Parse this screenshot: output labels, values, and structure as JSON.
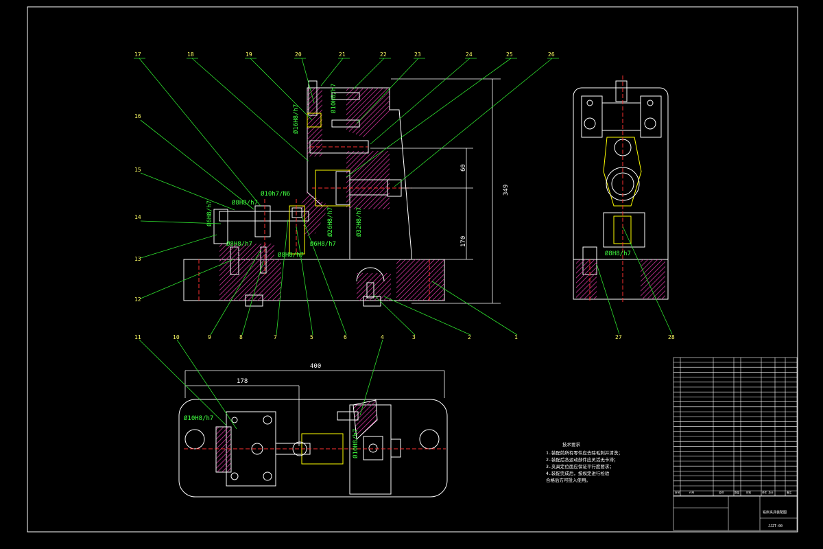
{
  "colors": {
    "background": "#000000",
    "outline": "#ffffff",
    "hatch": "#cc3399",
    "leader": "#2ee02e",
    "center": "#ff3030",
    "label": "#ffff66",
    "highlight": "#ffff00"
  },
  "front_view": {
    "dimensions": {
      "height_total": "349",
      "h60": "60",
      "h170": "170"
    },
    "fits": {
      "f_16h8": "Ø16H8/h7",
      "f_10h8": "Ø10H8/h7",
      "f_10n6": "Ø10h7/N6",
      "f_8h8a": "Ø8H8/h7",
      "f_6h8a": "Ø6H8/h7",
      "f_8h8b": "Ø8H8/h7",
      "f_8h8c": "Ø8H8/h7",
      "f_6h8b": "Ø6H8/h7",
      "f_26": "Ø26H8/h7",
      "f_32": "Ø32H8/h7"
    },
    "top_labels": [
      "17",
      "18",
      "19",
      "20",
      "21",
      "22",
      "23",
      "24",
      "25",
      "26"
    ],
    "left_labels": [
      "16",
      "15",
      "14",
      "13",
      "12"
    ],
    "bottom_labels": [
      "9",
      "8",
      "7",
      "5",
      "6",
      "3",
      "2",
      "1"
    ]
  },
  "side_view": {
    "fit": "Ø8H8/h7",
    "labels": [
      "27",
      "28"
    ]
  },
  "top_view": {
    "dimensions": {
      "w400": "400",
      "w178": "178"
    },
    "fits": {
      "f_10a": "Ø10H8/h7",
      "f_10b": "Ø10H8/h7"
    },
    "labels": [
      "11",
      "10",
      "4"
    ]
  },
  "notes": {
    "heading": "技术要求",
    "lines": [
      "1.装配前所有零件应去除毛刺并清洗；",
      "2.装配后各运动部件应灵活无卡滞；",
      "3.夹具定位面应保证平行度要求；",
      "4.装配完成后，按规定进行检验",
      "  合格后方可投入使用。"
    ]
  },
  "title_block": {
    "header": [
      "序号",
      "代号",
      "名称",
      "数量",
      "材料",
      "单件 总计",
      "备注"
    ],
    "drawing_title": "铣床夹具装配图",
    "drawing_number": "JJZT-00"
  }
}
